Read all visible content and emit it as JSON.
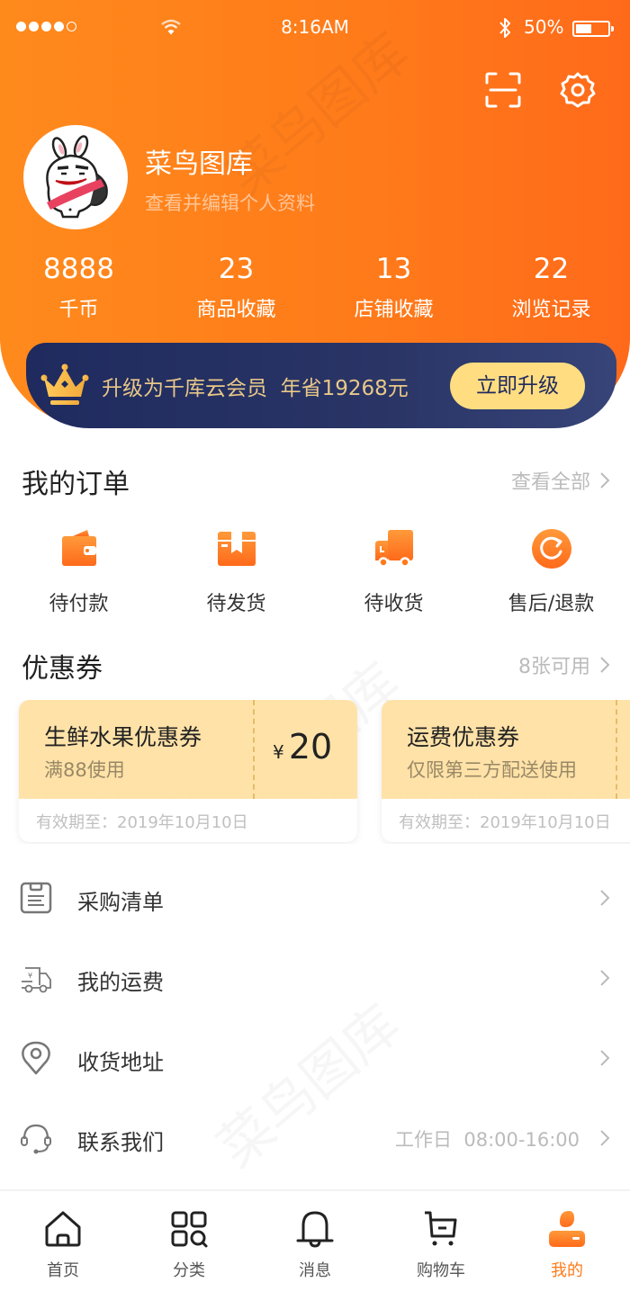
{
  "status_bar": {
    "time": "8:16AM",
    "battery_percent": "50%",
    "battery_level": 0.5,
    "signal_bars_filled": 4,
    "signal_bars_total": 5
  },
  "header": {
    "scan_icon": "scan-icon",
    "settings_icon": "gear-icon",
    "username": "菜鸟图库",
    "profile_link": "查看并编辑个人资料"
  },
  "stats": [
    {
      "value": "8888",
      "label": "千币"
    },
    {
      "value": "23",
      "label": "商品收藏"
    },
    {
      "value": "13",
      "label": "店铺收藏"
    },
    {
      "value": "22",
      "label": "浏览记录"
    }
  ],
  "vip": {
    "text": "升级为千库云会员  年省19268元",
    "button": "立即升级"
  },
  "orders": {
    "title": "我的订单",
    "link": "查看全部",
    "items": [
      {
        "label": "待付款",
        "icon": "wallet-icon"
      },
      {
        "label": "待发货",
        "icon": "package-icon"
      },
      {
        "label": "待收货",
        "icon": "truck-icon"
      },
      {
        "label": "售后/退款",
        "icon": "refund-icon"
      }
    ]
  },
  "coupons": {
    "title": "优惠券",
    "link": "8张可用",
    "items": [
      {
        "title": "生鲜水果优惠券",
        "condition": "满88使用",
        "currency": "¥",
        "amount": "20",
        "expiry": "有效期至：2019年10月10日"
      },
      {
        "title": "运费优惠券",
        "condition": "仅限第三方配送使用",
        "currency": "",
        "amount": "",
        "expiry": "有效期至：2019年10月10日"
      }
    ]
  },
  "menu": [
    {
      "label": "采购清单",
      "icon": "list-icon",
      "extra": ""
    },
    {
      "label": "我的运费",
      "icon": "shipping-fee-icon",
      "extra": ""
    },
    {
      "label": "收货地址",
      "icon": "location-icon",
      "extra": ""
    },
    {
      "label": "联系我们",
      "icon": "headset-icon",
      "extra": "工作日  08:00-16:00"
    }
  ],
  "tabbar": [
    {
      "label": "首页",
      "icon": "home-icon",
      "active": false
    },
    {
      "label": "分类",
      "icon": "category-icon",
      "active": false
    },
    {
      "label": "消息",
      "icon": "bell-icon",
      "active": false
    },
    {
      "label": "购物车",
      "icon": "cart-icon",
      "active": false
    },
    {
      "label": "我的",
      "icon": "user-icon",
      "active": true
    }
  ],
  "colors": {
    "brand_orange": "#ff7a1a",
    "vip_navy": "#1f2a5e",
    "vip_gold": "#ffdd80",
    "coupon_bg": "#ffe2a8"
  }
}
